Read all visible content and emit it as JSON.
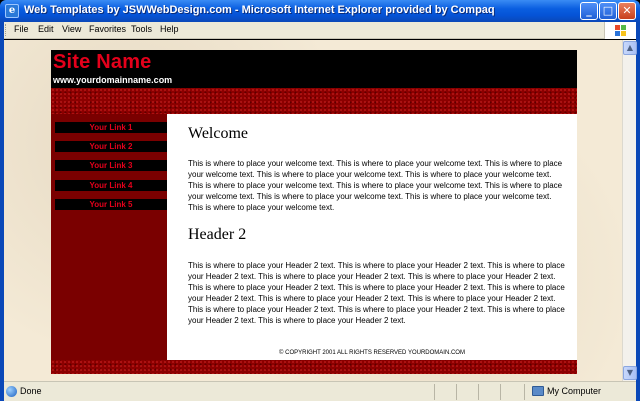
{
  "window": {
    "title": "Web Templates by JSWWebDesign.com - Microsoft Internet Explorer provided by Compaq",
    "minimize_glyph": "_",
    "maximize_glyph": "□",
    "close_glyph": "✕"
  },
  "menubar": {
    "items": [
      "File",
      "Edit",
      "View",
      "Favorites",
      "Tools",
      "Help"
    ]
  },
  "scrollbar": {
    "up_glyph": "▲",
    "down_glyph": "▼"
  },
  "site": {
    "name": "Site Name",
    "url": "www.yourdomainname.com",
    "links": [
      "Your Link 1",
      "Your Link 2",
      "Your Link 3",
      "Your Link 4",
      "Your Link 5"
    ],
    "welcome_heading": "Welcome",
    "welcome_text": "This is where to place your welcome text. This is where to place your welcome text. This is where to place your welcome text. This is where to place your welcome text. This is where to place your welcome text. This is where to place your welcome text. This is where to place your welcome text. This is where to place your welcome text. This is where to place your welcome text. This is where to place your welcome text. This is where to place your welcome text.",
    "header2_heading": "Header 2",
    "header2_text": "This is where to place your Header 2 text. This is where to place your Header 2 text. This is where to place your Header 2 text. This is where to place your Header 2 text. This is where to place your Header 2 text. This is where to place your Header 2 text. This is where to place your Header 2 text. This is where to place your Header 2 text. This is where to place your Header 2 text. This is where to place your Header 2 text. This is where to place your Header 2 text. This is where to place your Header 2 text. This is where to place your Header 2 text. This is where to place your Header 2 text.",
    "copyright": "© COPYRIGHT 2001 ALL RIGHTS RESERVED YOURDOMAIN.COM"
  },
  "statusbar": {
    "status": "Done",
    "zone": "My Computer"
  },
  "colors": {
    "titlebar_blue": "#0553d6",
    "site_red": "#e4001b",
    "sidebar_maroon": "#7a0000",
    "page_background": "#f4ead6"
  },
  "icons": {
    "app": "internet-explorer-icon",
    "status": "page-done-icon",
    "zone": "my-computer-icon",
    "logo": "windows-flag-icon"
  }
}
